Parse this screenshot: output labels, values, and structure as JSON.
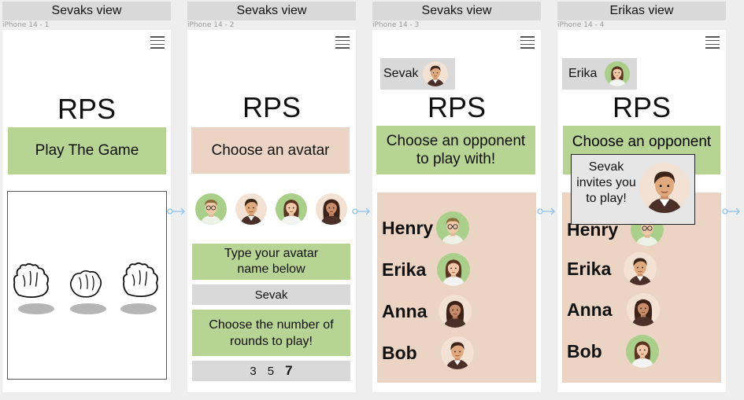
{
  "frames": [
    {
      "header": "Sevaks view",
      "caption": "iPhone 14 - 1"
    },
    {
      "header": "Sevaks view",
      "caption": "iPhone 14 - 2"
    },
    {
      "header": "Sevaks view",
      "caption": "iPhone 14 - 3"
    },
    {
      "header": "Erikas view",
      "caption": "iPhone 14 - 4"
    }
  ],
  "app_title": "RPS",
  "screen1": {
    "play_button": "Play The Game"
  },
  "screen2": {
    "choose_avatar": "Choose an avatar",
    "type_name_label": "Type your avatar name below",
    "name_value": "Sevak",
    "rounds_label": "Choose the number of rounds to play!",
    "rounds_options": [
      "3",
      "5",
      "7"
    ],
    "rounds_selected": "7"
  },
  "screen3": {
    "user_name": "Sevak",
    "heading": "Choose an opponent to play with!",
    "players": [
      "Henry",
      "Erika",
      "Anna",
      "Bob"
    ]
  },
  "screen4": {
    "user_name": "Erika",
    "heading": "Choose an opponent",
    "players": [
      "Henry",
      "Erika",
      "Anna",
      "Bob"
    ],
    "invite_text": "Sevak invites you to play!"
  },
  "colors": {
    "green": "#b7d494",
    "peach": "#ecd4c5",
    "gray": "#d9d9d9",
    "connector": "#8fc4ea"
  }
}
